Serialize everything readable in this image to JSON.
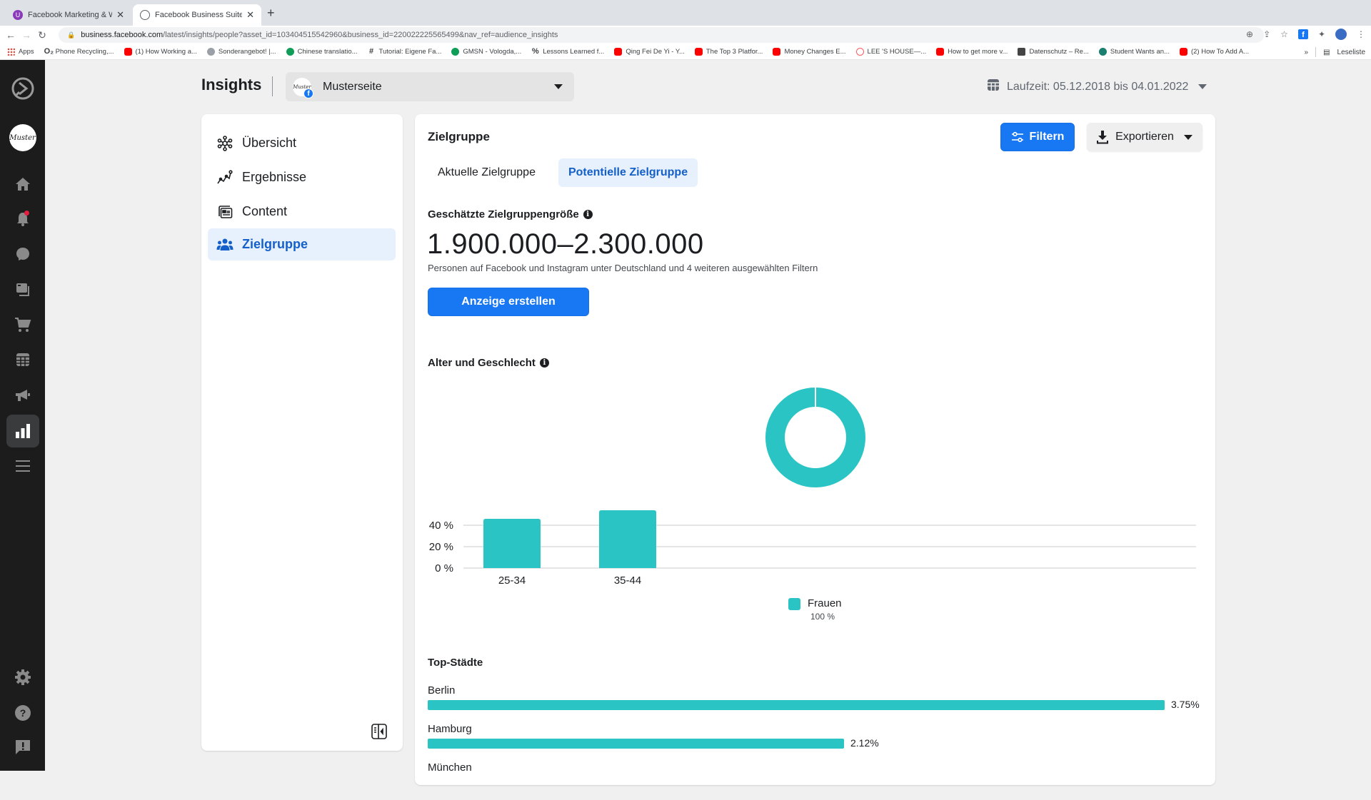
{
  "browser": {
    "tabs": [
      {
        "title": "Facebook Marketing & Werbea",
        "active": false
      },
      {
        "title": "Facebook Business Suite",
        "active": true
      }
    ],
    "url_host": "business.facebook.com",
    "url_path": "/latest/insights/people?asset_id=103404515542960&business_id=220022225565499&nav_ref=audience_insights",
    "bookmarks": [
      {
        "label": "Apps",
        "icon": "grid"
      },
      {
        "label": "Phone Recycling,...",
        "icon": "txt",
        "glyph": "O₂"
      },
      {
        "label": "(1) How Working a...",
        "icon": "yt"
      },
      {
        "label": "Sonderangebot! |...",
        "icon": "grey"
      },
      {
        "label": "Chinese translatio...",
        "icon": "round"
      },
      {
        "label": "Tutorial: Eigene Fa...",
        "icon": "txt",
        "glyph": "#"
      },
      {
        "label": "GMSN - Vologda,...",
        "icon": "round"
      },
      {
        "label": "Lessons Learned f...",
        "icon": "txt",
        "glyph": "%"
      },
      {
        "label": "Qing Fei De Yi - Y...",
        "icon": "yt"
      },
      {
        "label": "The Top 3 Platfor...",
        "icon": "yt"
      },
      {
        "label": "Money Changes E...",
        "icon": "yt"
      },
      {
        "label": "LEE 'S HOUSE—...",
        "icon": "air"
      },
      {
        "label": "How to get more v...",
        "icon": "yt"
      },
      {
        "label": "Datenschutz – Re...",
        "icon": "dark"
      },
      {
        "label": "Student Wants an...",
        "icon": "teal"
      },
      {
        "label": "(2) How To Add A...",
        "icon": "yt"
      }
    ],
    "more_bookmarks": "»",
    "reading_list": "Leseliste"
  },
  "rail": {
    "page_avatar_text": "Muster",
    "items": [
      "home",
      "notifications",
      "messages",
      "posts",
      "commerce",
      "planner",
      "ads",
      "insights",
      "menu"
    ],
    "bottom_items": [
      "settings",
      "help",
      "feedback"
    ],
    "active": "insights"
  },
  "header": {
    "title": "Insights",
    "page_selector": {
      "avatar_text": "Muster",
      "name": "Musterseite"
    },
    "date_range": "Laufzeit: 05.12.2018 bis 04.01.2022"
  },
  "left_nav": {
    "items": [
      {
        "label": "Übersicht",
        "icon": "overview-icon",
        "active": false
      },
      {
        "label": "Ergebnisse",
        "icon": "results-icon",
        "active": false
      },
      {
        "label": "Content",
        "icon": "content-icon",
        "active": false
      },
      {
        "label": "Zielgruppe",
        "icon": "audience-icon",
        "active": true
      }
    ]
  },
  "main": {
    "title": "Zielgruppe",
    "filter_label": "Filtern",
    "export_label": "Exportieren",
    "tabs": [
      {
        "label": "Aktuelle Zielgruppe",
        "active": false
      },
      {
        "label": "Potentielle Zielgruppe",
        "active": true
      }
    ],
    "estimated_size_label": "Geschätzte Zielgruppengröße",
    "estimated_size_value": "1.900.000–2.300.000",
    "estimated_size_sub": "Personen auf Facebook und Instagram unter Deutschland und 4 weiteren ausgewählten Filtern",
    "create_ad_label": "Anzeige erstellen",
    "age_gender_label": "Alter und Geschlecht",
    "top_cities_label": "Top-Städte",
    "cities": [
      {
        "name": "Berlin",
        "value": 3.75,
        "label": "3.75%"
      },
      {
        "name": "Hamburg",
        "value": 2.12,
        "label": "2.12%"
      },
      {
        "name": "München",
        "value": null,
        "label": ""
      }
    ]
  },
  "colors": {
    "accent": "#1877f2",
    "teal": "#2bc4c4",
    "active_bg": "#e7f0fd",
    "active_text": "#1460c8"
  },
  "chart_data": [
    {
      "type": "pie",
      "title": "Alter und Geschlecht",
      "donut": true,
      "slices": [
        {
          "name": "Frauen",
          "value": 100,
          "label": "100 %"
        }
      ],
      "legend": [
        {
          "name": "Frauen",
          "value_label": "100 %"
        }
      ],
      "legend_position": "bottom-center"
    },
    {
      "type": "bar",
      "categories": [
        "25-34",
        "35-44"
      ],
      "series": [
        {
          "name": "Frauen",
          "values": [
            46,
            54
          ]
        }
      ],
      "yticks": [
        "0 %",
        "20 %",
        "40 %"
      ],
      "ytick_values": [
        0,
        20,
        40
      ],
      "ylim": [
        0,
        60
      ],
      "grid": true,
      "xlabel": "",
      "ylabel": ""
    },
    {
      "type": "bar",
      "orientation": "horizontal",
      "title": "Top-Städte",
      "categories": [
        "Berlin",
        "Hamburg"
      ],
      "values": [
        3.75,
        2.12
      ],
      "value_labels": [
        "3.75%",
        "2.12%"
      ],
      "unit": "%"
    }
  ]
}
